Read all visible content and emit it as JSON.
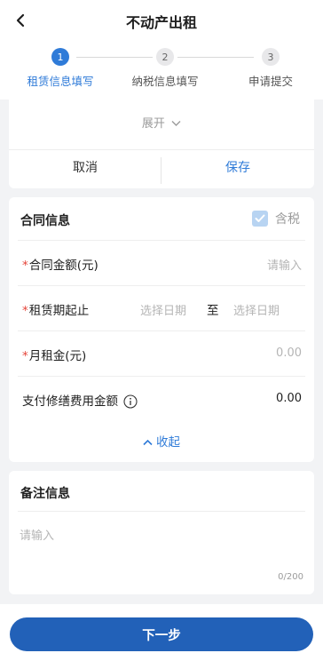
{
  "header": {
    "title": "不动产出租"
  },
  "steps": [
    {
      "number": "1",
      "label": "租赁信息填写"
    },
    {
      "number": "2",
      "label": "纳税信息填写"
    },
    {
      "number": "3",
      "label": "申请提交"
    }
  ],
  "top_card": {
    "expand_label": "展开",
    "cancel_label": "取消",
    "save_label": "保存"
  },
  "contract": {
    "title": "合同信息",
    "tax_label": "含税",
    "amount_label": "合同金额(元)",
    "amount_placeholder": "请输入",
    "period_label": "租赁期起止",
    "start_placeholder": "选择日期",
    "to_label": "至",
    "end_placeholder": "选择日期",
    "monthly_label": "月租金(元)",
    "monthly_value": "0.00",
    "repair_label": "支付修缮费用金额",
    "repair_value": "0.00",
    "collapse_label": "收起"
  },
  "notes": {
    "title": "备注信息",
    "placeholder": "请输入",
    "counter": "0/200"
  },
  "footer": {
    "next_label": "下一步"
  },
  "colors": {
    "accent": "#2f7bd8",
    "primary_button": "#2261b8",
    "required": "#e5453a"
  }
}
